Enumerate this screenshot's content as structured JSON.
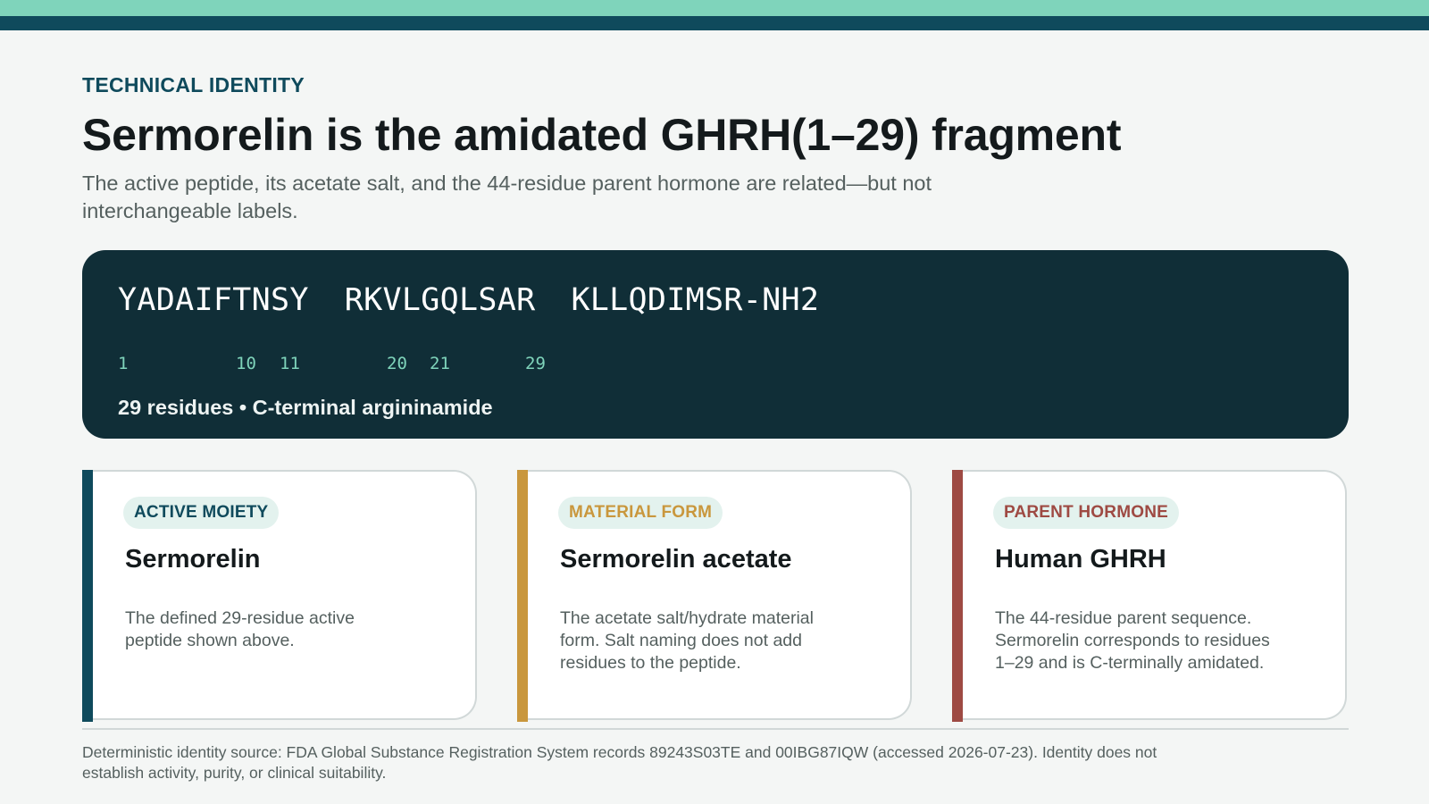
{
  "colors": {
    "accent_mint": "#7fd4bb",
    "accent_teal": "#0f4a5c",
    "panel_dark": "#102e37",
    "active_moiety": "#0f4a5c",
    "material_form": "#c9973d",
    "parent_hormone": "#9e4a43"
  },
  "header": {
    "eyebrow": "TECHNICAL IDENTITY",
    "title": "Sermorelin is the amidated GHRH(1–29) fragment",
    "subtitle": "The active peptide, its acetate salt, and the 44-residue parent hormone are related—but not interchangeable labels."
  },
  "sequence": {
    "segments": [
      "YADAIFTNSY",
      "RKVLGQLSAR",
      "KLLQDIMSR-NH2"
    ],
    "positions": [
      "1",
      "10",
      "11",
      "20",
      "21",
      "29"
    ],
    "caption": "29 residues • C-terminal argininamide"
  },
  "cards": [
    {
      "tag": "ACTIVE MOIETY",
      "name": "Sermorelin",
      "description": "The defined 29-residue active peptide shown above."
    },
    {
      "tag": "MATERIAL FORM",
      "name": "Sermorelin acetate",
      "description": "The acetate salt/hydrate material form. Salt naming does not add residues to the peptide."
    },
    {
      "tag": "PARENT HORMONE",
      "name": "Human GHRH",
      "description": "The 44-residue parent sequence. Sermorelin corresponds to residues 1–29 and is C-terminally amidated."
    }
  ],
  "footer": {
    "note": "Deterministic identity source: FDA Global Substance Registration System records 89243S03TE and 00IBG87IQW (accessed 2026-07-23). Identity does not establish activity, purity, or clinical suitability."
  }
}
